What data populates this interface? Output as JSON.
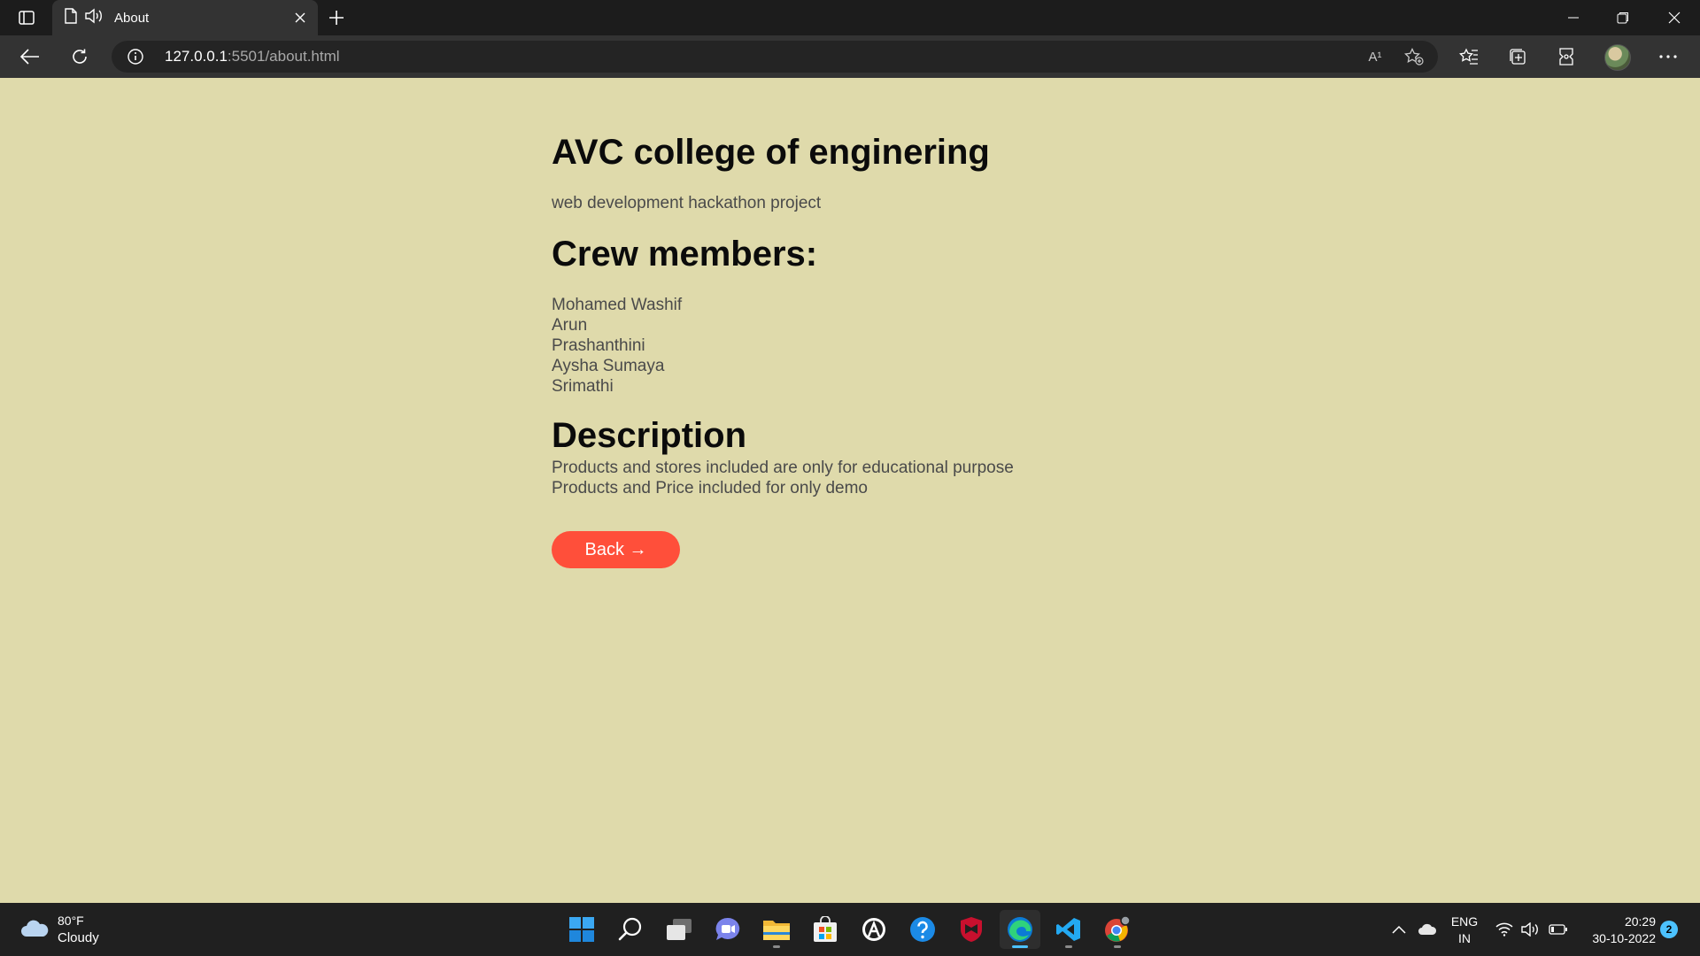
{
  "browser": {
    "tab": {
      "title": "About"
    },
    "address": {
      "host": "127.0.0.1",
      "path": ":5501/about.html"
    },
    "read_aloud_label": "A¹",
    "icons": [
      "tab-actions-icon",
      "document-icon",
      "speaker-icon",
      "close-icon",
      "plus-icon",
      "minimize-icon",
      "restore-icon",
      "close-window-icon",
      "back-arrow-icon",
      "refresh-icon",
      "info-icon",
      "read-aloud-icon",
      "add-favorite-icon",
      "favorites-icon",
      "collections-icon",
      "browser-essentials-icon",
      "avatar",
      "more-icon"
    ]
  },
  "page": {
    "title": "AVC college of enginering",
    "subtitle": "web development hackathon project",
    "crew_heading": "Crew members:",
    "crew": [
      "Mohamed Washif",
      "Arun",
      "Prashanthini",
      "Aysha Sumaya",
      "Srimathi"
    ],
    "description_heading": "Description",
    "description_lines": [
      "Products and stores included are only for educational purpose",
      "Products and Price included for only demo"
    ],
    "back_button": "Back →"
  },
  "taskbar": {
    "weather": {
      "temp": "80°F",
      "condition": "Cloudy"
    },
    "apps": [
      "start",
      "search",
      "task-view",
      "teams-chat",
      "file-explorer",
      "microsoft-store",
      "app-launcher",
      "help",
      "mcafee",
      "edge",
      "vscode",
      "chrome"
    ],
    "language": {
      "line1": "ENG",
      "line2": "IN"
    },
    "clock": {
      "time": "20:29",
      "date": "30-10-2022"
    },
    "notification_count": "2"
  },
  "colors": {
    "page_background": "#dfdaab",
    "back_button": "#ff4f3a",
    "tabstrip": "#1c1c1c",
    "toolbar": "#333333",
    "taskbar": "#202020",
    "accent": "#4cc2ff"
  }
}
